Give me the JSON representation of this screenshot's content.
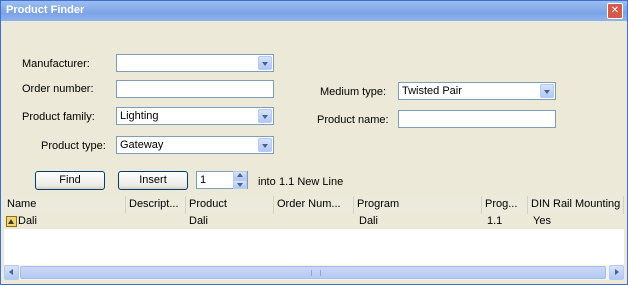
{
  "window": {
    "title": "Product Finder"
  },
  "form": {
    "manufacturer": {
      "label": "Manufacturer:",
      "value": ""
    },
    "order_number": {
      "label": "Order number:",
      "value": ""
    },
    "product_family": {
      "label": "Product family:",
      "value": "Lighting"
    },
    "product_type": {
      "label": "Product type:",
      "value": "Gateway"
    },
    "medium_type": {
      "label": "Medium type:",
      "value": "Twisted Pair"
    },
    "product_name": {
      "label": "Product name:",
      "value": ""
    }
  },
  "actions": {
    "find_label": "Find",
    "insert_label": "Insert",
    "quantity": "1",
    "into_text": "into",
    "target": "1.1 New Line"
  },
  "results": {
    "columns": [
      "Name",
      "Descript...",
      "Product",
      "Order Num...",
      "Program",
      "Prog...",
      "DIN Rail Mounting"
    ],
    "rows": [
      {
        "name": "Dali",
        "description": "",
        "product": "Dali",
        "order_number": "",
        "program": "Dali",
        "prog": "1.1",
        "din_rail": "Yes"
      }
    ]
  },
  "icons": {
    "close": "close-icon",
    "row": "gateway-icon"
  }
}
